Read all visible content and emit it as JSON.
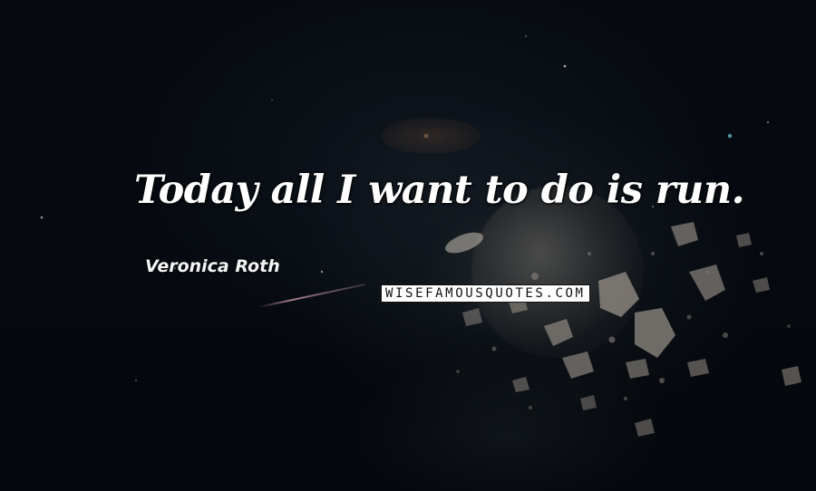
{
  "quote": {
    "text": "Today all I want to do is run.",
    "author": "Veronica Roth"
  },
  "watermark": {
    "text": "WISEFAMOUSQUOTES.COM"
  },
  "colors": {
    "background": "#05080d",
    "text": "#ffffff",
    "watermark_bg": "#ffffff",
    "watermark_text": "#111111"
  }
}
